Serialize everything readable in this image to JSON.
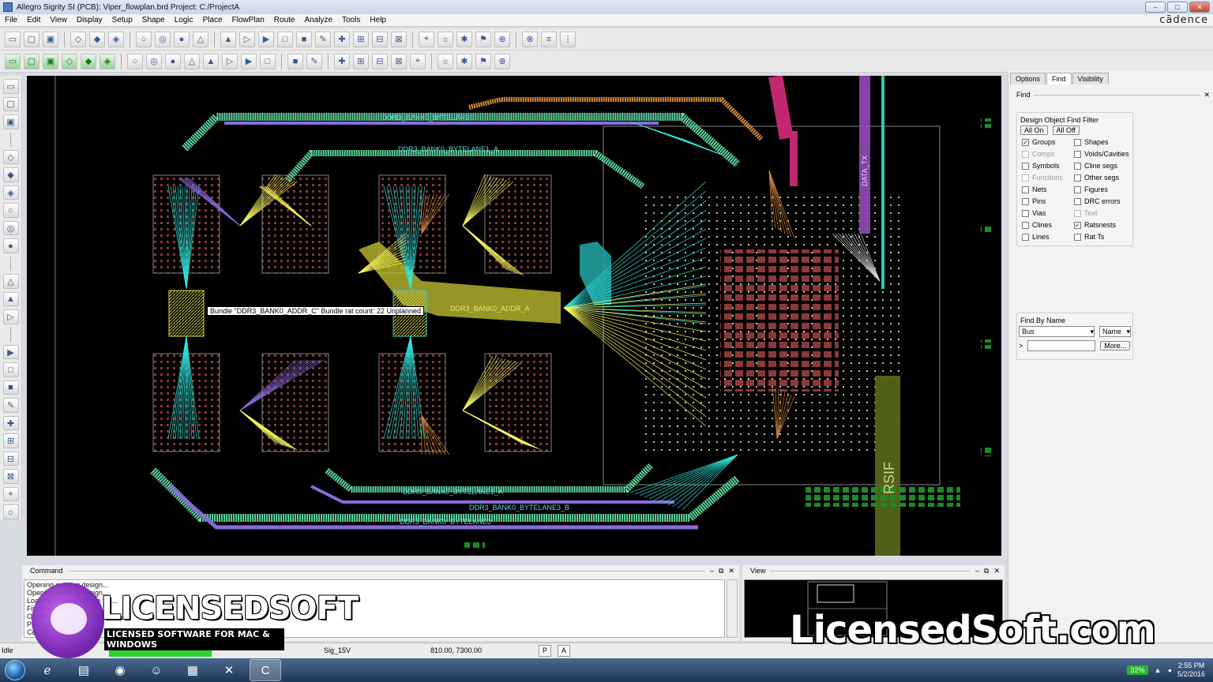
{
  "window": {
    "title": "Allegro Sigrity SI (PCB): Viper_flowplan.brd  Project: C:/ProjectA",
    "brand": "cādence",
    "controls": {
      "minimize": "–",
      "maximize": "□",
      "close": "✕"
    }
  },
  "menu": [
    "File",
    "Edit",
    "View",
    "Display",
    "Setup",
    "Shape",
    "Logic",
    "Place",
    "FlowPlan",
    "Route",
    "Analyze",
    "Tools",
    "Help"
  ],
  "canvas": {
    "tooltip": "Bundle \"DDR3_BANK0_ADDR_C\"  Bundle rat count: 22  Unplanned",
    "labels": {
      "byte0_top": "DDR3_BANK0_BYTELANE0",
      "byte1_top": "DDR3_BANK0_BYTELANE1_A",
      "addr_a": "DDR3_BANK0_ADDR_A",
      "byte_bot1": "DDR3_BANK0_BYTELANE1_A",
      "byte_bot2": "DDR3_BANK0_BYTELANE3_B",
      "byte_bot3": "DDR3_BANK0_BYTELANE0",
      "data_tx": "DATA_TX",
      "rsif": "RSIF"
    }
  },
  "right_panel": {
    "tabs": [
      "Options",
      "Find",
      "Visibility"
    ],
    "active_tab": "Find",
    "header": "Find",
    "filter": {
      "title": "Design Object Find Filter",
      "all_on": "All On",
      "all_off": "All Off",
      "items": [
        {
          "label": "Groups",
          "checked": true,
          "enabled": true
        },
        {
          "label": "Shapes",
          "checked": false,
          "enabled": true
        },
        {
          "label": "Comps",
          "checked": false,
          "enabled": false
        },
        {
          "label": "Voids/Cavities",
          "checked": false,
          "enabled": true
        },
        {
          "label": "Symbols",
          "checked": false,
          "enabled": true
        },
        {
          "label": "Cline segs",
          "checked": false,
          "enabled": true
        },
        {
          "label": "Functions",
          "checked": false,
          "enabled": false
        },
        {
          "label": "Other segs",
          "checked": false,
          "enabled": true
        },
        {
          "label": "Nets",
          "checked": false,
          "enabled": true
        },
        {
          "label": "Figures",
          "checked": false,
          "enabled": true
        },
        {
          "label": "Pins",
          "checked": false,
          "enabled": true
        },
        {
          "label": "DRC errors",
          "checked": false,
          "enabled": true
        },
        {
          "label": "Vias",
          "checked": false,
          "enabled": true
        },
        {
          "label": "Text",
          "checked": false,
          "enabled": false
        },
        {
          "label": "Clines",
          "checked": false,
          "enabled": true
        },
        {
          "label": "Ratsnests",
          "checked": true,
          "enabled": true
        },
        {
          "label": "Lines",
          "checked": false,
          "enabled": true
        },
        {
          "label": "Rat Ts",
          "checked": false,
          "enabled": true
        }
      ]
    },
    "find_by_name": {
      "title": "Find By Name",
      "type_value": "Bus",
      "mode_value": "Name",
      "prompt": ">",
      "more": "More..."
    }
  },
  "command": {
    "title": "Command",
    "lines": [
      "Opening existing design...",
      "Opening existing design...",
      "Loading existing device file...",
      "Finished SigNoise...",
      "Opening ...",
      "Pal... com...",
      "Co..."
    ]
  },
  "view": {
    "title": "View"
  },
  "status": {
    "mode": "Idle",
    "layer": "Sig_15V",
    "coords": "810.00, 7300.00",
    "p": "P",
    "a": "A"
  },
  "taskbar": {
    "battery": "32%",
    "time": "2:55 PM",
    "date": "5/2/2016"
  },
  "watermark": {
    "logo_text": "LICENSEDSOFT",
    "logo_tag": "LICENSED SOFTWARE FOR MAC & WINDOWS",
    "url": "LicensedSoft.com"
  },
  "colors": {
    "canvas_bg": "#000000",
    "bus_green": "#5fd8a0",
    "bus_purple": "#8a6ad8",
    "bus_orange": "#d88a40",
    "fan_yellow": "#ffff60",
    "fan_cyan": "#30e8e0",
    "pad_red": "#a04040",
    "highlight_yellow": "#bcbc30",
    "teal_block": "#20a0a0",
    "magenta": "#c02870",
    "lavender": "#9a50c0",
    "rsif_olive": "#5a6a1a"
  },
  "icons": {
    "toolbar1": [
      "new-file-icon",
      "open-folder-icon",
      "save-icon",
      "move-icon",
      "copy-icon",
      "delete-icon",
      "undo-icon",
      "redo-icon",
      "add-connect-icon",
      "pin-icon",
      "grid-icon",
      "zoom-fit-icon",
      "zoom-icon",
      "zoom-in-icon",
      "zoom-out-icon",
      "zoom-world-icon",
      "zoom-prev-icon",
      "refresh-icon",
      "layers-icon",
      "info-icon",
      "properties-icon",
      "measure-icon",
      "color-icon",
      "sun-icon",
      "shadow-icon",
      "bars-icon",
      "hourglass-icon",
      "toggle-icon"
    ],
    "toolbar2": [
      "green-1-icon",
      "green-2-icon",
      "green-3-icon",
      "green-4-icon",
      "green-5-icon",
      "green-6-icon",
      "shape-1-icon",
      "shape-2-icon",
      "shape-3-icon",
      "shape-4-icon",
      "shape-5-icon",
      "shape-6-icon",
      "shape-7-icon",
      "shape-8-icon",
      "place-icon",
      "route-icon",
      "tree-1-icon",
      "tree-2-icon",
      "tree-3-icon",
      "tree-4-icon",
      "tree-5-icon",
      "window-1-icon",
      "window-2-icon",
      "window-3-icon",
      "help-icon"
    ],
    "left": [
      "place-manual-icon",
      "place-comp-icon",
      "swap-icon",
      "route-connect-icon",
      "slide-icon",
      "delay-tune-icon",
      "custom-smooth-icon",
      "spread-icon",
      "via-icon",
      "add-line-icon",
      "add-rect-icon",
      "flow-icon",
      "bundle-icon",
      "plan-1-icon",
      "plan-2-icon",
      "plan-3-icon",
      "plan-4-icon",
      "plan-5-icon",
      "plan-6-icon",
      "plan-7-icon",
      "plan-8-icon",
      "plan-9-icon"
    ]
  }
}
